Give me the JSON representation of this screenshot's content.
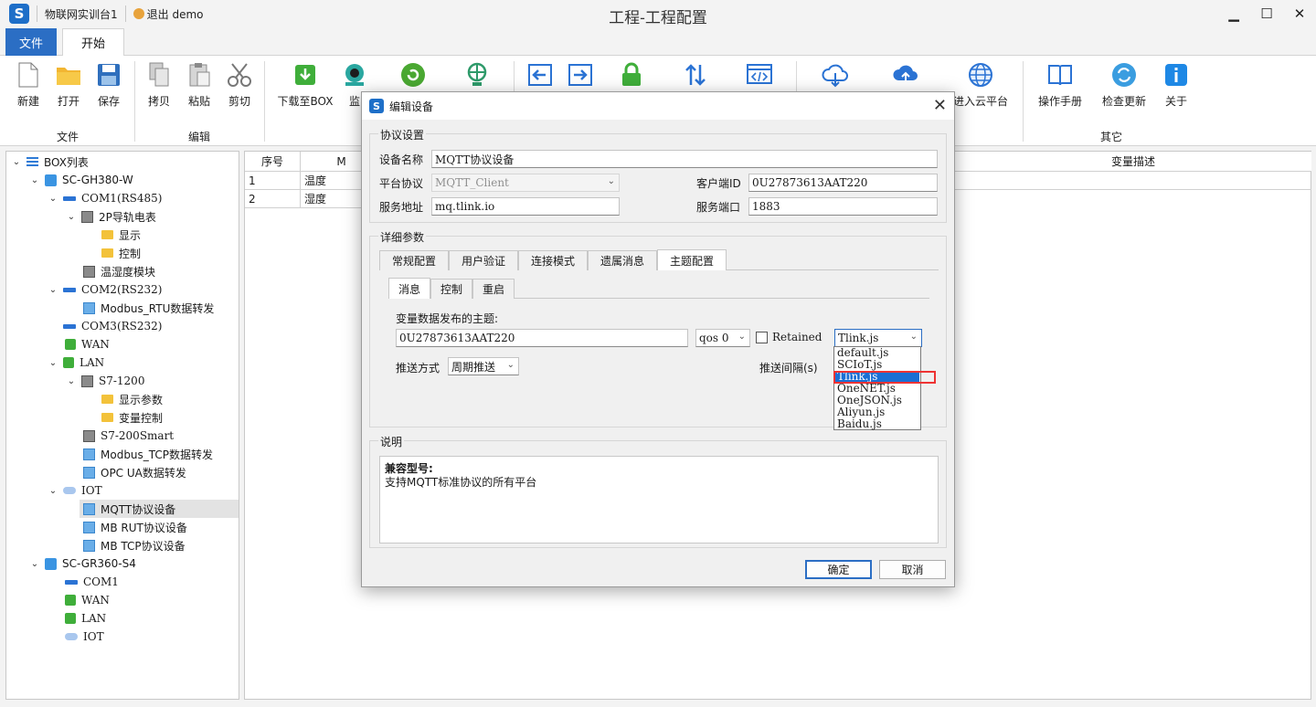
{
  "titlebar": {
    "station": "物联网实训台1",
    "logout": "退出 demo",
    "window_title": "工程-工程配置",
    "min": "▁",
    "max": "☐",
    "close": "✕"
  },
  "ribbon_tabs": {
    "file": "文件",
    "start": "开始"
  },
  "ribbon": {
    "buttons": [
      "新建",
      "打开",
      "保存",
      "拷贝",
      "粘贴",
      "剪切",
      "下载至BOX",
      "监",
      "进入云平台",
      "操作手册",
      "检查更新",
      "关于"
    ],
    "groups": [
      "文件",
      "编辑",
      "其它"
    ]
  },
  "tree": [
    "BOX列表",
    "SC-GH380-W",
    "COM1(RS485)",
    "2P导轨电表",
    "显示",
    "控制",
    "温湿度模块",
    "COM2(RS232)",
    "Modbus_RTU数据转发",
    "COM3(RS232)",
    "WAN",
    "LAN",
    "S7-1200",
    "显示参数",
    "变量控制",
    "S7-200Smart",
    "Modbus_TCP数据转发",
    "OPC UA数据转发",
    "IOT",
    "MQTT协议设备",
    "MB RUT协议设备",
    "MB TCP协议设备",
    "SC-GR360-S4",
    "COM1",
    "WAN",
    "LAN",
    "IOT"
  ],
  "grid": {
    "headers": [
      "序号",
      "M",
      "变量描述"
    ],
    "rows": [
      [
        "1",
        "温度"
      ],
      [
        "2",
        "湿度"
      ]
    ]
  },
  "dialog": {
    "title": "编辑设备",
    "close": "✕",
    "protocol_section": "协议设置",
    "labels": {
      "device_name": "设备名称",
      "platform": "平台协议",
      "client_id": "客户端ID",
      "server_addr": "服务地址",
      "server_port": "服务端口"
    },
    "values": {
      "device_name": "MQTT协议设备",
      "platform": "MQTT_Client",
      "client_id": "0U27873613AAT220",
      "server_addr": "mq.tlink.io",
      "server_port": "1883"
    },
    "detail_section": "详细参数",
    "tabs": [
      "常规配置",
      "用户验证",
      "连接模式",
      "遗属消息",
      "主题配置"
    ],
    "subtabs": [
      "消息",
      "控制",
      "重启"
    ],
    "topic_label": "变量数据发布的主题:",
    "topic_value": "0U27873613AAT220",
    "qos_value": "qos 0",
    "retained_label": "Retained",
    "script_value": "Tlink.js",
    "script_options": [
      "default.js",
      "SCIoT.js",
      "Tlink.js",
      "OneNET.js",
      "OneJSON.js",
      "Aliyun.js",
      "Baidu.js"
    ],
    "push_mode_label": "推送方式",
    "push_mode_value": "周期推送",
    "push_interval_label": "推送间隔(s)",
    "desc_section": "说明",
    "desc_title": "兼容型号:",
    "desc_text": "支持MQTT标准协议的所有平台",
    "ok": "确定",
    "cancel": "取消"
  }
}
